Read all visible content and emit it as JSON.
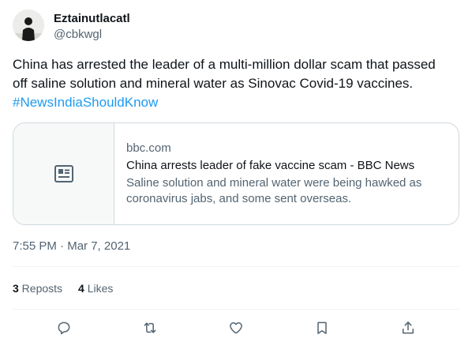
{
  "author": {
    "display_name": "Eztainutlacatl",
    "handle": "@cbkwgl",
    "avatar_icon": "silhouette-avatar-icon"
  },
  "tweet": {
    "text_lines": [
      "China has arrested the leader of a multi-million dollar scam that passed",
      "off saline solution and mineral water as Sinovac Covid-19 vaccines."
    ],
    "hashtag": "#NewsIndiaShouldKnow"
  },
  "card": {
    "icon": "news-article-icon",
    "domain": "bbc.com",
    "title": "China arrests leader of fake vaccine scam - BBC News",
    "description": "Saline solution and mineral water were being hawked as coronavirus jabs, and some sent overseas."
  },
  "timestamp": {
    "time": "7:55 PM",
    "separator": " · ",
    "date": "Mar 7, 2021"
  },
  "stats": {
    "reposts_count": "3",
    "reposts_label": " Reposts",
    "likes_count": "4",
    "likes_label": " Likes"
  },
  "actions": [
    "reply-icon",
    "repost-icon",
    "like-icon",
    "bookmark-icon",
    "share-icon"
  ],
  "colors": {
    "text": "#0f1419",
    "secondary": "#536471",
    "link": "#1d9bf0",
    "border": "#cfd9de",
    "divider": "#eff3f4"
  }
}
